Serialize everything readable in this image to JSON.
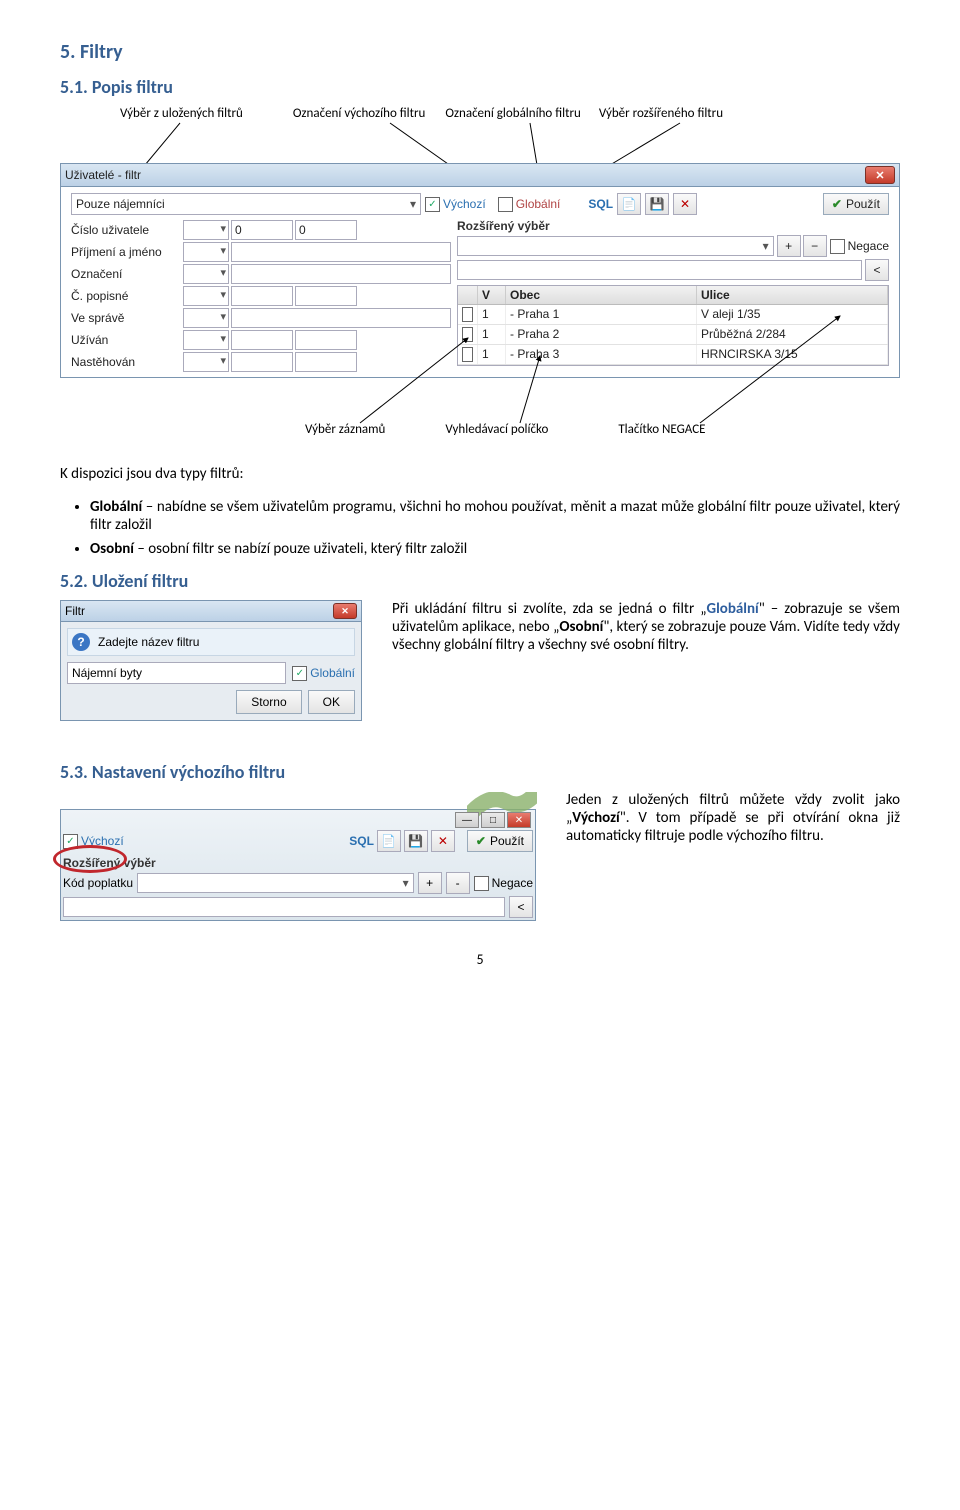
{
  "headings": {
    "h5": "5. Filtry",
    "h5_1": "5.1. Popis filtru",
    "h5_2": "5.2. Uložení filtru",
    "h5_3": "5.3. Nastavení výchozího filtru"
  },
  "annotations": {
    "top": {
      "a": "Výběr z uložených filtrů",
      "b": "Označení výchozího filtru",
      "c": "Označení globálního filtru",
      "d": "Výběr rozšířeného filtru"
    },
    "bottom": {
      "a": "Výběr záznamů",
      "b": "Vyhledávací políčko",
      "c": "Tlačítko NEGACE"
    }
  },
  "win1": {
    "title": "Uživatelé - filtr",
    "preset": "Pouze nájemníci",
    "vychozi": "Výchozí",
    "globalni": "Globální",
    "sql": "SQL",
    "pouzit": "Použít",
    "rozsireny": "Rozšířený výběr",
    "negace": "Negace",
    "fields": [
      "Číslo uživatele",
      "Příjmení a jméno",
      "Označení",
      "Č. popisné",
      "Ve správě",
      "Užíván",
      "Nastěhován"
    ],
    "zero": "0",
    "table": {
      "v": "V",
      "obec": "Obec",
      "ulice": "Ulice",
      "rows": [
        {
          "n": "1",
          "obec": "- Praha 1",
          "ulice": "V aleji 1/35"
        },
        {
          "n": "1",
          "obec": "- Praha 2",
          "ulice": "Průběžná 2/284"
        },
        {
          "n": "1",
          "obec": "- Praha 3",
          "ulice": "HRNCIRSKA 3/15"
        }
      ]
    },
    "lt": "<"
  },
  "para1_intro": "K dispozici jsou dva typy filtrů:",
  "bullets1": [
    {
      "b": "Globální",
      "t": " – nabídne se všem uživatelům programu, všichni ho mohou používat, měnit a mazat může globální filtr pouze uživatel, který filtr založil"
    },
    {
      "b": "Osobní",
      "t": " – osobní filtr se nabízí pouze uživateli, který filtr založil"
    }
  ],
  "dlg": {
    "title": "Filtr",
    "prompt": "Zadejte název filtru",
    "label": "Nájemní byty",
    "global": "Globální",
    "storno": "Storno",
    "ok": "OK"
  },
  "para2": {
    "p1a": "Při ukládání filtru si zvolíte, zda se jedná o filtr „",
    "g": "Globální",
    "p1b": "\" – zobrazuje se všem uživatelům aplikace, nebo „",
    "o": "Osobní",
    "p1c": "\", který se zobrazuje pouze Vám. Vidíte tedy vždy všechny globální filtry a všechny své osobní filtry."
  },
  "shot3": {
    "vychozi": "Výchozí",
    "sql": "SQL",
    "pouzit": "Použít",
    "rozsireny": "Rozšířený výběr",
    "kod": "Kód poplatku",
    "negace": "Negace",
    "plus": "+",
    "minus": "-",
    "lt": "<"
  },
  "para3": {
    "a": "Jeden z uložených filtrů můžete vždy zvolit jako „",
    "v": "Výchozí",
    "b": "\". V tom případě se při otvírání okna již automaticky filtruje podle výchozího filtru."
  },
  "page": "5"
}
